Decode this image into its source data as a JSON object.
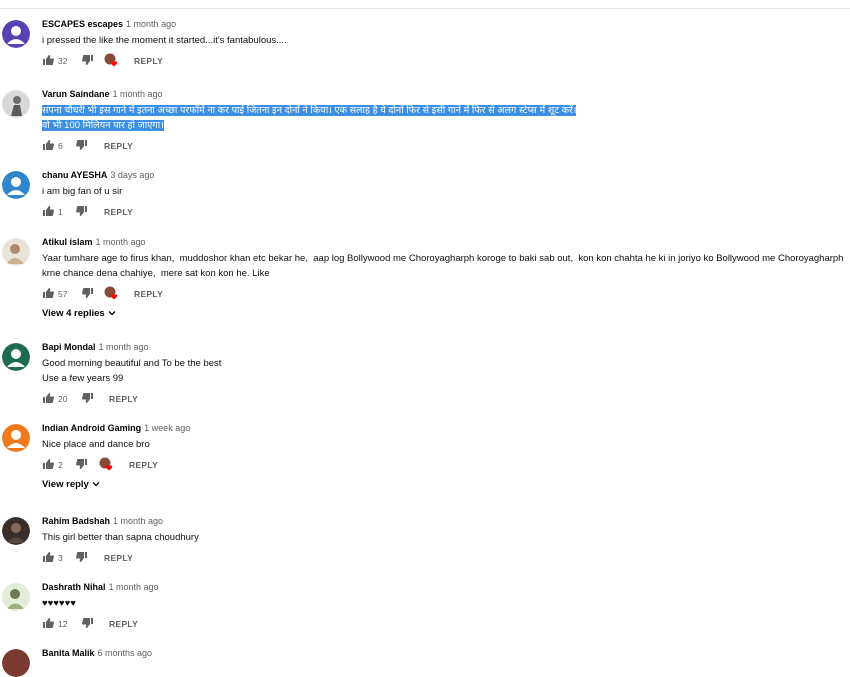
{
  "comments": [
    {
      "author": "ESCAPES escapes",
      "time": "1 month ago",
      "lines": [
        "i pressed the like the moment it started...it's fantabulous...."
      ],
      "likes": "32",
      "creator_heart": true,
      "reply_label": "REPLY",
      "avatar_color": "#5b3fb5",
      "avatar_letter": "E"
    },
    {
      "author": "Varun Saindane",
      "time": "1 month ago",
      "lines": [
        "सपना चौधरी भी इस गाने में इतना अच्छा परफॉर्म ना कर पाई जितना इन दोनों ने किया। एक सलाह है ये दोनों फिर से इसी गाने में फिर से अलग स्टेप्स में शूट करें।",
        "वो भी 100 मिलियन पार हो जाएगा।"
      ],
      "likes": "6",
      "creator_heart": false,
      "reply_label": "REPLY",
      "avatar_color": "#9a9a9a",
      "avatar_letter": ""
    },
    {
      "author": "chanu AYESHA",
      "time": "3 days ago",
      "lines": [
        "i am big fan of u sir"
      ],
      "likes": "1",
      "creator_heart": false,
      "reply_label": "REPLY",
      "avatar_color": "#2f86cc",
      "avatar_letter": ""
    },
    {
      "author": "Atikul islam",
      "time": "1 month ago",
      "lines": [
        "Yaar tumhare age to firus khan,  muddoshor khan etc bekar he,  aap log Bollywood me Choroyagharph koroge to baki sab out,  kon kon chahta he ki in joriyo ko Bollywood me Choroyagharph",
        "krne chance dena chahiye,  mere sat kon kon he. Like"
      ],
      "likes": "57",
      "creator_heart": true,
      "reply_label": "REPLY",
      "replies_label": "View 4 replies",
      "avatar_color": "#c8b49a",
      "avatar_letter": ""
    },
    {
      "author": "Bapi Mondal",
      "time": "1 month ago",
      "lines": [
        "Good morning beautiful and To be the best",
        "Use a few years 99"
      ],
      "likes": "20",
      "creator_heart": false,
      "reply_label": "REPLY",
      "avatar_color": "#1e6b4f",
      "avatar_letter": ""
    },
    {
      "author": "Indian Android Gaming",
      "time": "1 week ago",
      "lines": [
        "Nice place and dance bro"
      ],
      "likes": "2",
      "creator_heart": true,
      "reply_label": "REPLY",
      "replies_label": "View reply",
      "avatar_color": "#f07a1c",
      "avatar_letter": ""
    },
    {
      "author": "Rahim Badshah",
      "time": "1 month ago",
      "lines": [
        "This girl better than sapna choudhury"
      ],
      "likes": "3",
      "creator_heart": false,
      "reply_label": "REPLY",
      "avatar_color": "#4a3b36",
      "avatar_letter": ""
    },
    {
      "author": "Dashrath Nihal",
      "time": "1 month ago",
      "lines": [
        "♥♥♥♥♥♥"
      ],
      "likes": "12",
      "creator_heart": false,
      "reply_label": "REPLY",
      "avatar_color": "#b7c9a3",
      "avatar_letter": ""
    },
    {
      "author": "Banita Malik",
      "time": "6 months ago",
      "lines": [],
      "likes": "",
      "creator_heart": false,
      "reply_label": "",
      "avatar_color": "#7a3a2f",
      "avatar_letter": ""
    }
  ]
}
